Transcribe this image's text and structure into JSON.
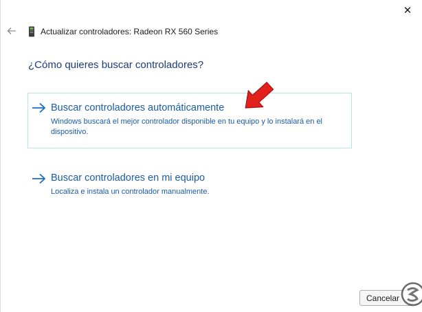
{
  "window": {
    "title": "Actualizar controladores: Radeon RX 560 Series",
    "close_glyph": "✕",
    "back_icon": "back-arrow-icon",
    "device_icon": "device-icon"
  },
  "main": {
    "question": "¿Cómo quieres buscar controladores?",
    "options": [
      {
        "title": "Buscar controladores automáticamente",
        "description": "Windows buscará el mejor controlador disponible en tu equipo y lo instalará en el dispositivo.",
        "icon": "arrow-right-icon",
        "selected": true
      },
      {
        "title": "Buscar controladores en mi equipo",
        "description": "Localiza e instala un controlador manualmente.",
        "icon": "arrow-right-icon",
        "selected": false
      }
    ]
  },
  "annotation": {
    "icon": "red-pointer-arrow-icon",
    "color": "#e3211c"
  },
  "footer": {
    "cancel_label": "Cancelar"
  },
  "colors": {
    "accent": "#1a5ba6",
    "heading": "#1c3b7a",
    "selection_border": "#b9dff2"
  }
}
